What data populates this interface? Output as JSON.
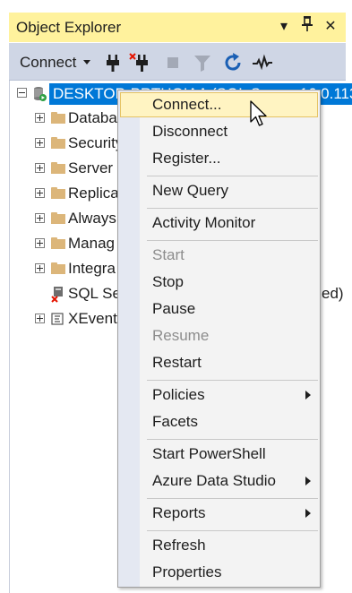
{
  "panel": {
    "title": "Object Explorer",
    "buttons": {
      "dropdown": "▾",
      "pin": "📌",
      "close": "✕"
    }
  },
  "toolbar": {
    "connect_label": "Connect",
    "icons": [
      "connect-plug-icon",
      "disconnect-plug-icon",
      "stop-icon",
      "filter-icon",
      "refresh-icon",
      "activity-monitor-icon"
    ]
  },
  "tree": {
    "server_label": "DESKTOP-PRTHGIAA (SQL Server 16.0.113",
    "nodes": [
      {
        "label": "Databa",
        "expander": "plus",
        "icon": "folder-icon"
      },
      {
        "label": "Security",
        "expander": "plus",
        "icon": "folder-icon"
      },
      {
        "label": "Server C",
        "expander": "plus",
        "icon": "folder-icon"
      },
      {
        "label": "Replica",
        "expander": "plus",
        "icon": "folder-icon"
      },
      {
        "label": "Always",
        "expander": "plus",
        "icon": "folder-icon"
      },
      {
        "label": "Manag",
        "expander": "plus",
        "icon": "folder-icon"
      },
      {
        "label": "Integra",
        "expander": "plus",
        "icon": "folder-icon"
      },
      {
        "label": "SQL Se",
        "expander": "none",
        "icon": "sql-agent-icon",
        "trailing": "ed)"
      },
      {
        "label": "XEvent",
        "expander": "plus",
        "icon": "xevent-icon"
      }
    ]
  },
  "context_menu": {
    "items": [
      {
        "label": "Connect...",
        "state": "hover"
      },
      {
        "label": "Disconnect"
      },
      {
        "label": "Register..."
      },
      {
        "label": "New Query"
      },
      {
        "label": "Activity Monitor"
      },
      {
        "label": "Start",
        "state": "disabled"
      },
      {
        "label": "Stop"
      },
      {
        "label": "Pause"
      },
      {
        "label": "Resume",
        "state": "disabled"
      },
      {
        "label": "Restart"
      },
      {
        "label": "Policies",
        "submenu": true
      },
      {
        "label": "Facets"
      },
      {
        "label": "Start PowerShell"
      },
      {
        "label": "Azure Data Studio",
        "submenu": true
      },
      {
        "label": "Reports",
        "submenu": true
      },
      {
        "label": "Refresh"
      },
      {
        "label": "Properties"
      }
    ]
  },
  "colors": {
    "title_bg": "#fff29d",
    "toolbar_bg": "#cfd6e5",
    "selection": "#0078d7",
    "menu_hover": "#fff4c2"
  }
}
